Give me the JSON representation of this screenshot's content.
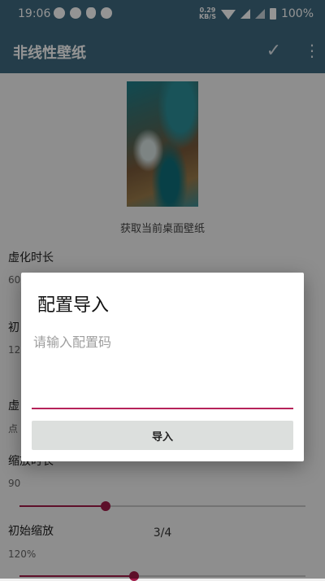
{
  "status_bar": {
    "time": "19:06",
    "network_speed": "0.29",
    "network_speed_unit": "KB/S",
    "battery": "100%"
  },
  "app_bar": {
    "title": "非线性壁纸",
    "check_icon": "check-icon",
    "more_icon": "more-vert-icon"
  },
  "content": {
    "wallpaper_caption": "获取当前桌面壁纸",
    "settings": [
      {
        "label": "虚化时长",
        "value": "60"
      },
      {
        "label": "初",
        "value": "12"
      },
      {
        "label": "虚",
        "value": "点"
      },
      {
        "label": "缩放时长",
        "value": "90",
        "slider": 0.3
      },
      {
        "label": "初始缩放",
        "value": "120%",
        "slider": 0.4
      }
    ],
    "page_indicator": "3/4"
  },
  "dialog": {
    "title": "配置导入",
    "input_value": "",
    "input_placeholder": "请输入配置码",
    "import_button": "导入"
  },
  "colors": {
    "app_bar": "#3f6a80",
    "accent": "#a01a48",
    "button_bg": "#dcdfdd"
  }
}
